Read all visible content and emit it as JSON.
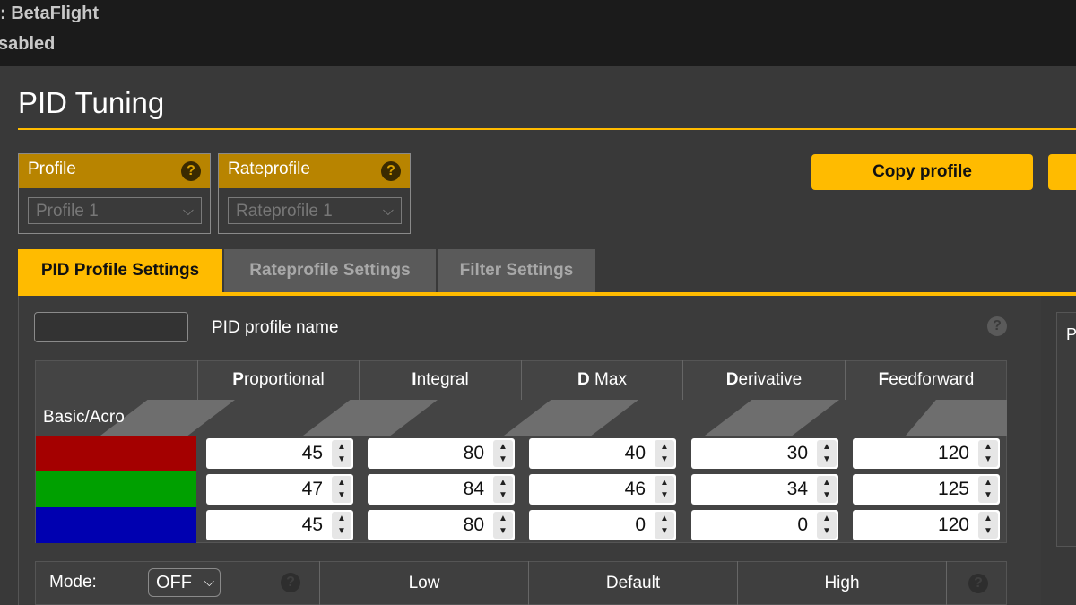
{
  "topbar": {
    "line1": ": BetaFlight",
    "line2": "sabled"
  },
  "page": {
    "title": "PID Tuning"
  },
  "profile": {
    "label": "Profile",
    "help": "?",
    "selected": "Profile 1"
  },
  "rateprofile": {
    "label": "Rateprofile",
    "help": "?",
    "selected": "Rateprofile 1"
  },
  "buttons": {
    "copy_profile": "Copy profile"
  },
  "tabs": [
    {
      "label": "PID Profile Settings",
      "active": true
    },
    {
      "label": "Rateprofile Settings",
      "active": false
    },
    {
      "label": "Filter Settings",
      "active": false
    }
  ],
  "pid_profile": {
    "name_label": "PID profile name",
    "name_value": "",
    "help": "?"
  },
  "pid_table": {
    "row_group_label": "Basic/Acro",
    "columns": [
      {
        "initial": "P",
        "rest": "roportional"
      },
      {
        "initial": "I",
        "rest": "ntegral"
      },
      {
        "initial": "D",
        "rest": " Max"
      },
      {
        "initial": "D",
        "rest": "erivative"
      },
      {
        "initial": "F",
        "rest": "eedforward"
      }
    ],
    "rows": [
      {
        "axis_color": "#a40000",
        "values": [
          "45",
          "80",
          "40",
          "30",
          "120"
        ]
      },
      {
        "axis_color": "#00a000",
        "values": [
          "47",
          "84",
          "46",
          "34",
          "125"
        ]
      },
      {
        "axis_color": "#0000b0",
        "values": [
          "45",
          "80",
          "0",
          "0",
          "120"
        ]
      }
    ],
    "spinner_up": "▲",
    "spinner_down": "▼"
  },
  "mode": {
    "label": "Mode:",
    "selected": "OFF",
    "help": "?",
    "levels": [
      "Low",
      "Default",
      "High"
    ],
    "help2": "?"
  },
  "right_panel": {
    "label": "P"
  },
  "colors": {
    "accent": "#ffbb00",
    "accent_dark": "#b88400",
    "background": "#393939"
  }
}
